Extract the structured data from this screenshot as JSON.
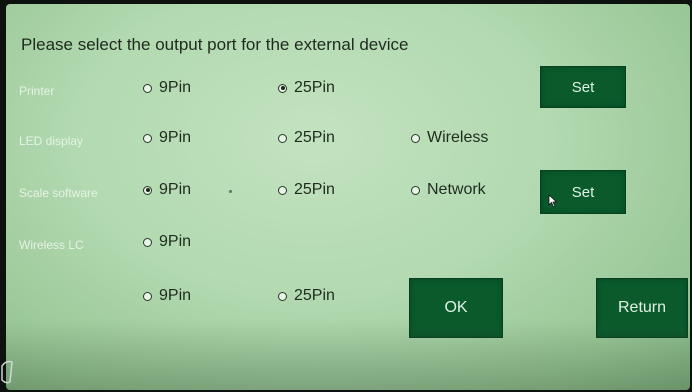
{
  "title": "Please select the output port for the external device",
  "rows": [
    {
      "label": "Printer",
      "options": [
        {
          "label": "9Pin",
          "selected": false
        },
        {
          "label": "25Pin",
          "selected": true
        }
      ],
      "set_label": "Set"
    },
    {
      "label": "LED display",
      "options": [
        {
          "label": "9Pin",
          "selected": false
        },
        {
          "label": "25Pin",
          "selected": false
        },
        {
          "label": "Wireless",
          "selected": false
        }
      ]
    },
    {
      "label": "Scale software",
      "options": [
        {
          "label": "9Pin",
          "selected": true
        },
        {
          "label": "25Pin",
          "selected": false
        },
        {
          "label": "Network",
          "selected": false
        }
      ],
      "set_label": "Set"
    },
    {
      "label": "Wireless LC",
      "options": [
        {
          "label": "9Pin",
          "selected": false
        }
      ]
    },
    {
      "label": "",
      "options": [
        {
          "label": "9Pin",
          "selected": false
        },
        {
          "label": "25Pin",
          "selected": false
        }
      ]
    }
  ],
  "buttons": {
    "ok": "OK",
    "return": "Return"
  },
  "colors": {
    "button_bg": "#0a5a2c",
    "screen_bg": "#b2d9b0"
  }
}
